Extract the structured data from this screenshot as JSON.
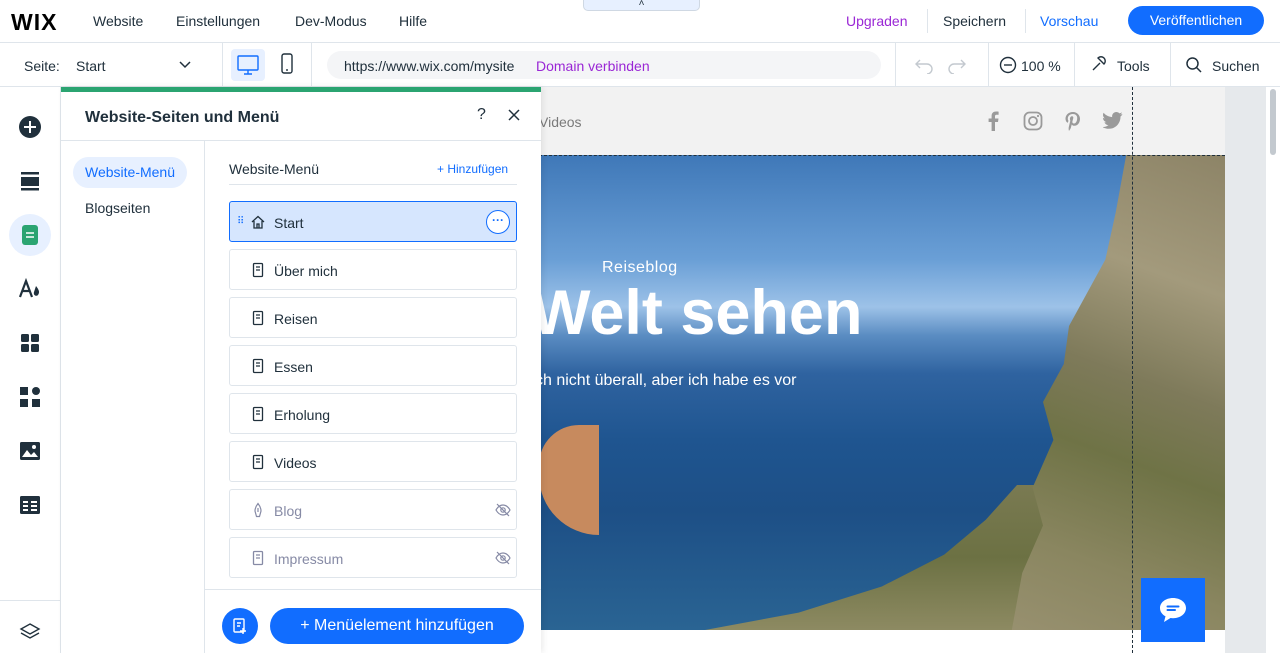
{
  "topbar": {
    "logo": "WIX",
    "menu": [
      "Website",
      "Einstellungen",
      "Dev-Modus",
      "Hilfe"
    ],
    "collapse": "˄",
    "upgrade": "Upgraden",
    "save": "Speichern",
    "preview": "Vorschau",
    "publish": "Veröffentlichen"
  },
  "subbar": {
    "page_label": "Seite:",
    "page_value": "Start",
    "url": "https://www.wix.com/mysite",
    "domain": "Domain verbinden",
    "zoom": "100 %",
    "tools": "Tools",
    "search": "Suchen"
  },
  "rail": {
    "icons": [
      "add-icon",
      "sections-icon",
      "pages-icon",
      "design-icon",
      "apps-icon",
      "business-icon",
      "media-icon",
      "cms-icon",
      "layers-icon"
    ],
    "active": "pages-icon"
  },
  "panel": {
    "title": "Website-Seiten und Menü",
    "help": "?",
    "nav": [
      "Website-Menü",
      "Blogseiten"
    ],
    "menu_heading": "Website-Menü",
    "add_link": "+ Hinzufügen",
    "items": [
      {
        "label": "Start",
        "icon": "home-icon",
        "selected": true,
        "hidden": false
      },
      {
        "label": "Über mich",
        "icon": "page-icon",
        "selected": false,
        "hidden": false
      },
      {
        "label": "Reisen",
        "icon": "page-icon",
        "selected": false,
        "hidden": false
      },
      {
        "label": "Essen",
        "icon": "page-icon",
        "selected": false,
        "hidden": false
      },
      {
        "label": "Erholung",
        "icon": "page-icon",
        "selected": false,
        "hidden": false
      },
      {
        "label": "Videos",
        "icon": "page-icon",
        "selected": false,
        "hidden": false
      },
      {
        "label": "Blog",
        "icon": "blog-icon",
        "selected": false,
        "hidden": true
      },
      {
        "label": "Impressum",
        "icon": "page-icon",
        "selected": false,
        "hidden": true
      }
    ],
    "add_button": "+ Menüelement hinzufügen"
  },
  "site": {
    "nav_partial": "Videos",
    "social": [
      "facebook-icon",
      "instagram-icon",
      "pinterest-icon",
      "twitter-icon"
    ],
    "hero_subtitle": "Reiseblog",
    "hero_title": "Welt sehen",
    "hero_text": "ch nicht überall, aber ich habe es vor"
  },
  "colors": {
    "accent": "#116dff",
    "upgrade": "#9a27d5",
    "panel_top": "#2ba471"
  }
}
